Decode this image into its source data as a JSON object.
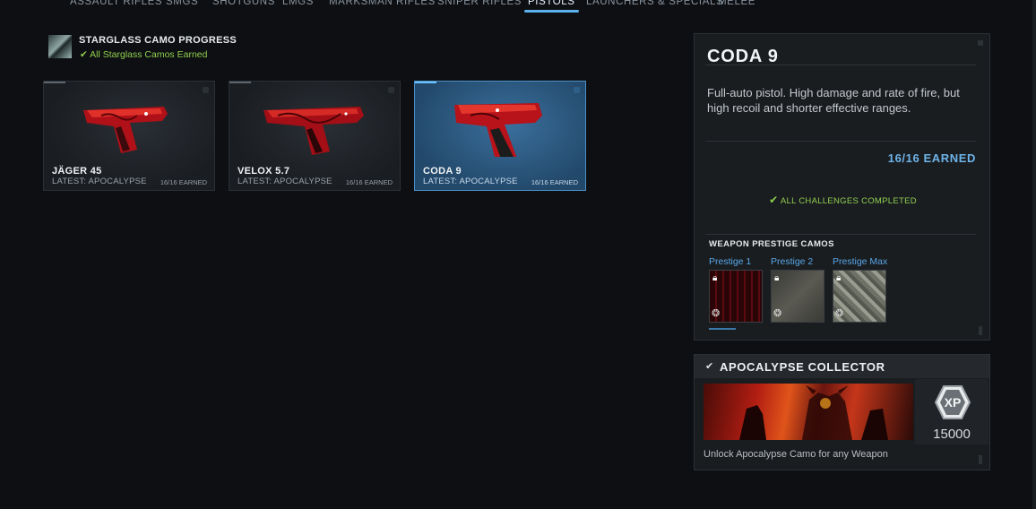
{
  "categories": [
    "ASSAULT RIFLES",
    "SMGS",
    "SHOTGUNS",
    "LMGS",
    "MARKSMAN RIFLES",
    "SNIPER RIFLES",
    "PISTOLS",
    "LAUNCHERS & SPECIALS",
    "MELEE"
  ],
  "active_category": "PISTOLS",
  "progress": {
    "title": "STARGLASS CAMO PROGRESS",
    "check": "✔",
    "subtitle": "All Starglass Camos Earned"
  },
  "weapons": [
    {
      "name": "JÄGER 45",
      "latest": "LATEST: APOCALYPSE",
      "earned": "16/16 EARNED"
    },
    {
      "name": "VELOX 5.7",
      "latest": "LATEST: APOCALYPSE",
      "earned": "16/16 EARNED"
    },
    {
      "name": "CODA 9",
      "latest": "LATEST: APOCALYPSE",
      "earned": "16/16 EARNED"
    }
  ],
  "detail": {
    "title": "CODA 9",
    "description": "Full-auto pistol. High damage and rate of fire, but high recoil and shorter effective ranges.",
    "earned": "16/16 EARNED",
    "challenges_check": "✔",
    "challenges": "ALL CHALLENGES COMPLETED",
    "prestige_title": "WEAPON PRESTIGE CAMOS",
    "prestige": [
      {
        "label": "Prestige 1"
      },
      {
        "label": "Prestige 2"
      },
      {
        "label": "Prestige Max"
      }
    ]
  },
  "challenge": {
    "check": "✔",
    "title": "APOCALYPSE COLLECTOR",
    "xp_label": "XP",
    "xp_value": "15000",
    "description": "Unlock Apocalypse Camo for any Weapon"
  },
  "colors": {
    "accent_blue": "#5ab2ee",
    "success_green": "#8fcf4f",
    "camo_red": "#c8141c"
  },
  "icons": {
    "progress": "starglass-camo-icon",
    "check": "check-icon",
    "lock": "lock-icon",
    "prestige": "prestige-swirl-icon",
    "xp": "xp-badge-icon"
  }
}
